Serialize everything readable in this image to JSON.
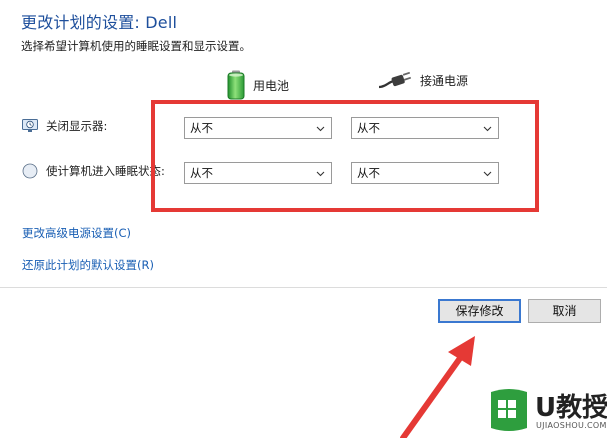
{
  "header": {
    "title": "更改计划的设置: Dell",
    "subtitle": "选择希望计算机使用的睡眠设置和显示设置。"
  },
  "columns": {
    "battery_label": "用电池",
    "plugged_label": "接通电源"
  },
  "rows": [
    {
      "label": "关闭显示器:",
      "battery_value": "从不",
      "plugged_value": "从不"
    },
    {
      "label": "使计算机进入睡眠状态:",
      "battery_value": "从不",
      "plugged_value": "从不"
    }
  ],
  "links": {
    "advanced": "更改高级电源设置(C)",
    "restore": "还原此计划的默认设置(R)"
  },
  "buttons": {
    "save": "保存修改",
    "cancel": "取消"
  },
  "watermark": {
    "logo_text": "U教授",
    "url": "UJIAOSHOU.COM"
  },
  "colors": {
    "title": "#1e4f9c",
    "link": "#1a5fb4",
    "highlight": "#e53935",
    "arrow": "#e53935",
    "save_border": "#3a78d0",
    "battery": "#3cb043",
    "watermark_green": "#2e9e3e"
  },
  "icons": {
    "battery": "battery-icon",
    "plug": "power-plug-icon",
    "display": "display-clock-icon",
    "sleep": "moon-icon",
    "dropdown": "chevron-down-icon"
  }
}
